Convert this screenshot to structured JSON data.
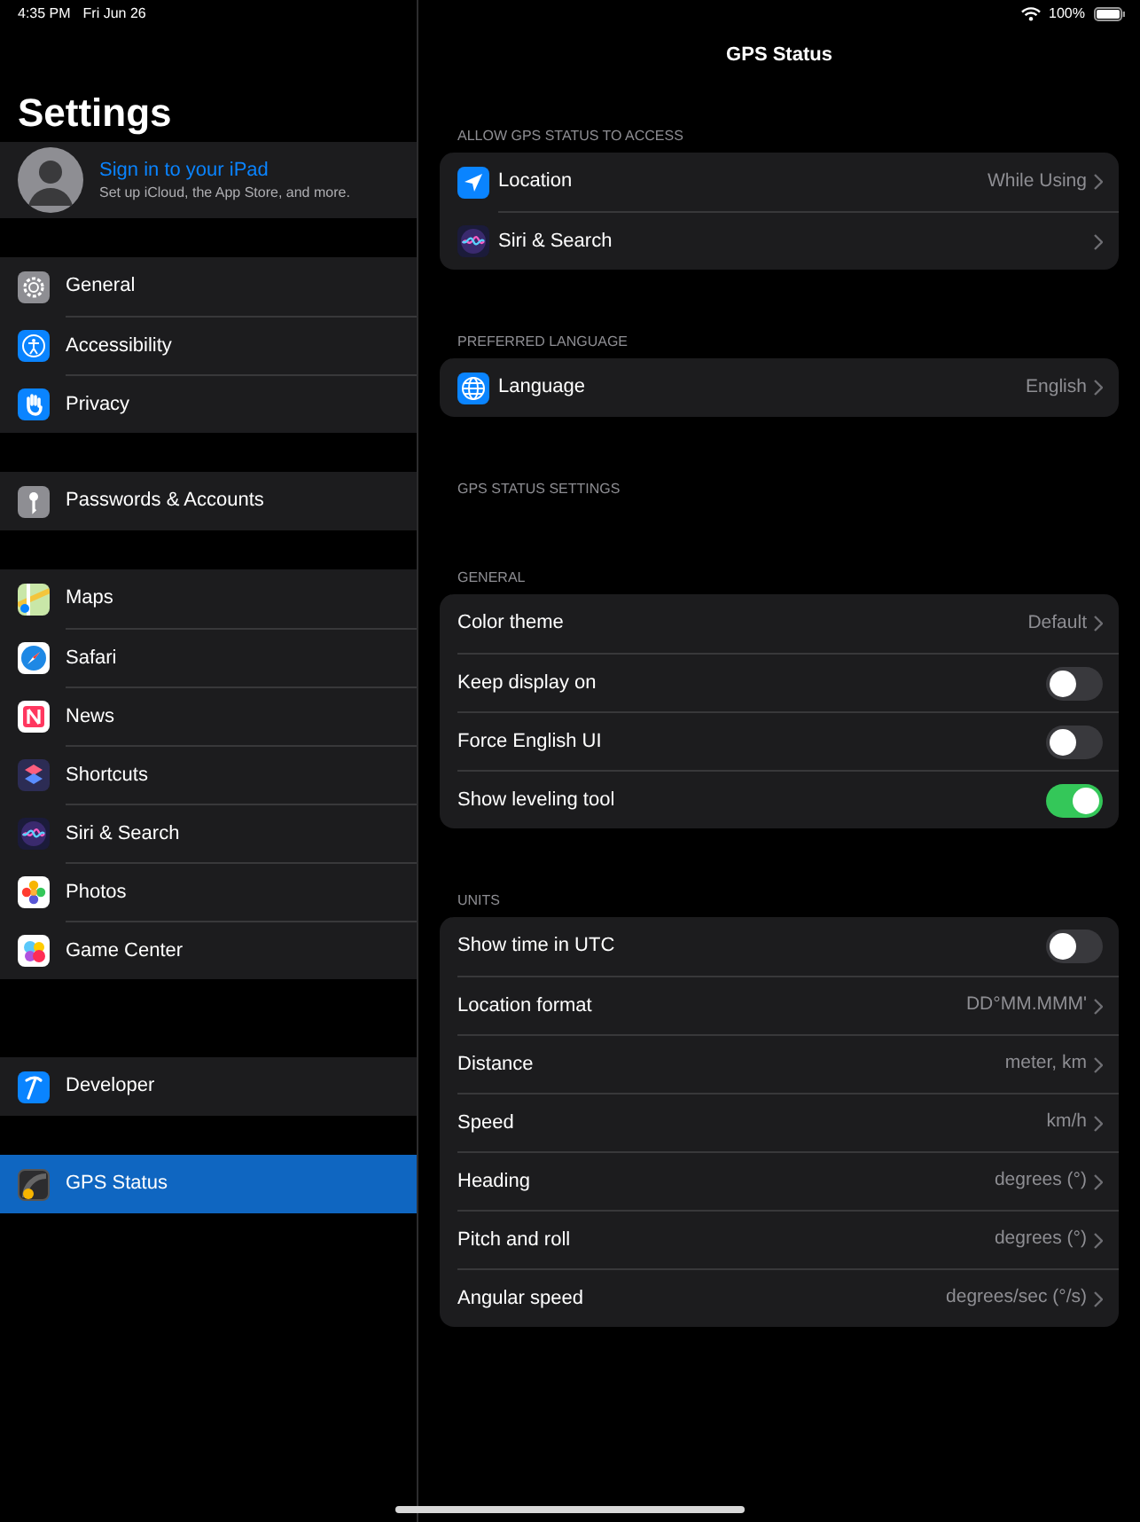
{
  "status_bar": {
    "time": "4:35 PM",
    "date": "Fri Jun 26",
    "battery": "100%"
  },
  "sidebar": {
    "title": "Settings",
    "account": {
      "title": "Sign in to your iPad",
      "subtitle": "Set up iCloud, the App Store, and more."
    },
    "groups": [
      [
        {
          "label": "General",
          "selected": false
        },
        {
          "label": "Accessibility",
          "selected": false
        },
        {
          "label": "Privacy",
          "selected": false
        }
      ],
      [
        {
          "label": "Passwords & Accounts",
          "selected": false
        }
      ],
      [
        {
          "label": "Maps",
          "selected": false
        },
        {
          "label": "Safari",
          "selected": false
        },
        {
          "label": "News",
          "selected": false
        },
        {
          "label": "Shortcuts",
          "selected": false
        },
        {
          "label": "Siri & Search",
          "selected": false
        },
        {
          "label": "Photos",
          "selected": false
        },
        {
          "label": "Game Center",
          "selected": false
        }
      ],
      [
        {
          "label": "Developer",
          "selected": false
        }
      ],
      [
        {
          "label": "GPS Status",
          "selected": true
        }
      ]
    ]
  },
  "detail": {
    "title": "GPS Status",
    "sections": [
      {
        "header": "ALLOW GPS STATUS TO ACCESS",
        "rows": [
          {
            "kind": "link",
            "label": "Location",
            "value": "While Using"
          },
          {
            "kind": "link",
            "label": "Siri & Search"
          }
        ]
      },
      {
        "header": "PREFERRED LANGUAGE",
        "rows": [
          {
            "kind": "link",
            "label": "Language",
            "value": "English"
          }
        ]
      },
      {
        "header": "GPS STATUS SETTINGS"
      },
      {
        "header": "GENERAL",
        "rows": [
          {
            "kind": "link",
            "label": "Color theme",
            "value": "Default"
          },
          {
            "kind": "toggle",
            "label": "Keep display on",
            "on": false
          },
          {
            "kind": "toggle",
            "label": "Force English UI",
            "on": false
          },
          {
            "kind": "toggle",
            "label": "Show leveling tool",
            "on": true
          }
        ]
      },
      {
        "header": "UNITS",
        "rows": [
          {
            "kind": "toggle",
            "label": "Show time in UTC",
            "on": false
          },
          {
            "kind": "link",
            "label": "Location format",
            "value": "DD°MM.MMM'"
          },
          {
            "kind": "link",
            "label": "Distance",
            "value": "meter, km"
          },
          {
            "kind": "link",
            "label": "Speed",
            "value": "km/h"
          },
          {
            "kind": "link",
            "label": "Heading",
            "value": "degrees (°)"
          },
          {
            "kind": "link",
            "label": "Pitch and roll",
            "value": "degrees (°)"
          },
          {
            "kind": "link",
            "label": "Angular speed",
            "value": "degrees/sec (°/s)"
          }
        ]
      }
    ]
  }
}
